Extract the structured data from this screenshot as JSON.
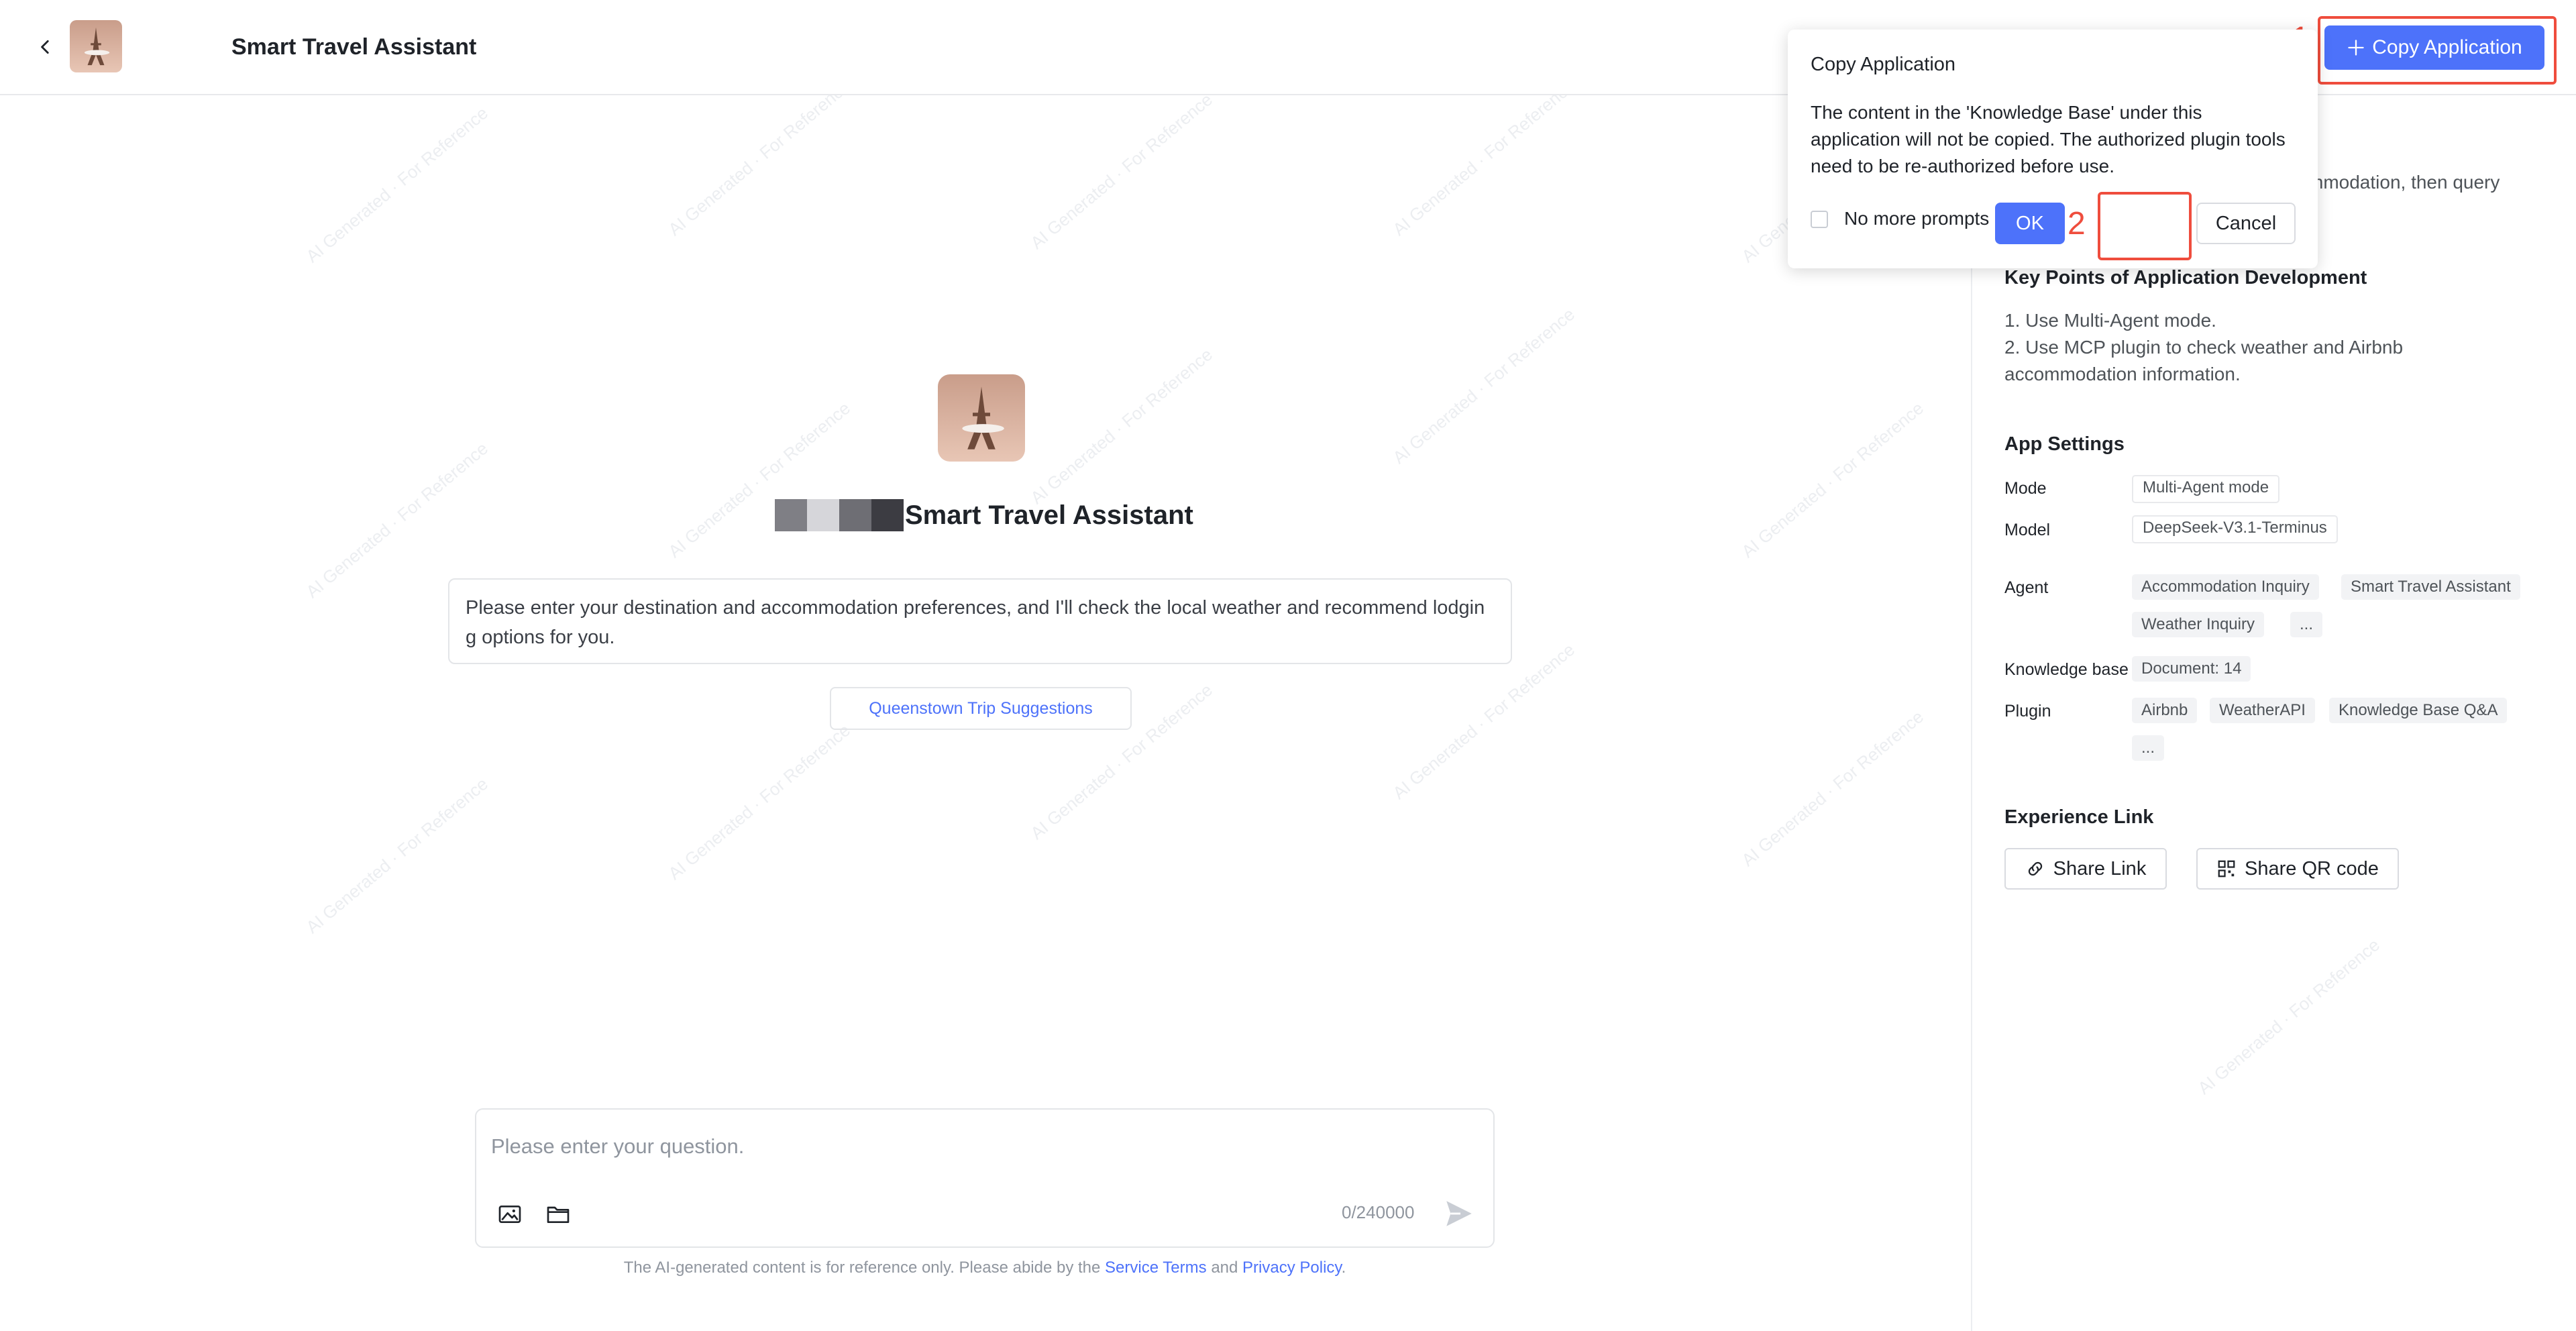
{
  "header": {
    "title": "Smart Travel Assistant",
    "copy_button": "Copy Application"
  },
  "annotations": {
    "step1": "1",
    "step2": "2"
  },
  "colors": {
    "accent": "#4d72fa",
    "annotation_red": "#ef4d3d"
  },
  "center": {
    "title": "Smart Travel Assistant",
    "intro": "Please enter your destination and accommodation preferences, and I'll check the local weather and recommend lodgin g options for you.",
    "suggestion": "Queenstown Trip Suggestions"
  },
  "chat_input": {
    "placeholder": "Please enter your question.",
    "counter": "0/240000"
  },
  "disclaimer": {
    "prefix": "The AI-generated content is for reference only. Please abide by the",
    "service_terms": "Service Terms",
    "and": "and",
    "privacy_policy": "Privacy Policy",
    "suffix": "."
  },
  "popup": {
    "title": "Copy Application",
    "body": "The content in the 'Knowledge Base' under this application will not be copied. The authorized plugin tools need to be re-authorized before use.",
    "no_more_prompts": "No more prompts",
    "ok": "OK",
    "cancel": "Cancel"
  },
  "panel": {
    "desc_line1_visible": "mmodation, then query",
    "key_points_title": "Key Points of Application Development",
    "key_points": [
      "1. Use Multi-Agent mode.",
      "2. Use MCP plugin to check weather and Airbnb accommodation information."
    ],
    "app_settings_title": "App Settings",
    "mode_label": "Mode",
    "mode_value": "Multi-Agent mode",
    "model_label": "Model",
    "model_value": "DeepSeek-V3.1-Terminus",
    "agent_label": "Agent",
    "agents": [
      "Accommodation Inquiry",
      "Smart Travel Assistant",
      "Weather Inquiry",
      "..."
    ],
    "kb_label": "Knowledge base",
    "kb_value": "Document: 14",
    "plugin_label": "Plugin",
    "plugins": [
      "Airbnb",
      "WeatherAPI",
      "Knowledge Base Q&A",
      "..."
    ],
    "experience_title": "Experience Link",
    "share_link": "Share Link",
    "share_qr": "Share QR code"
  },
  "watermark": "AI Generated · For Reference"
}
